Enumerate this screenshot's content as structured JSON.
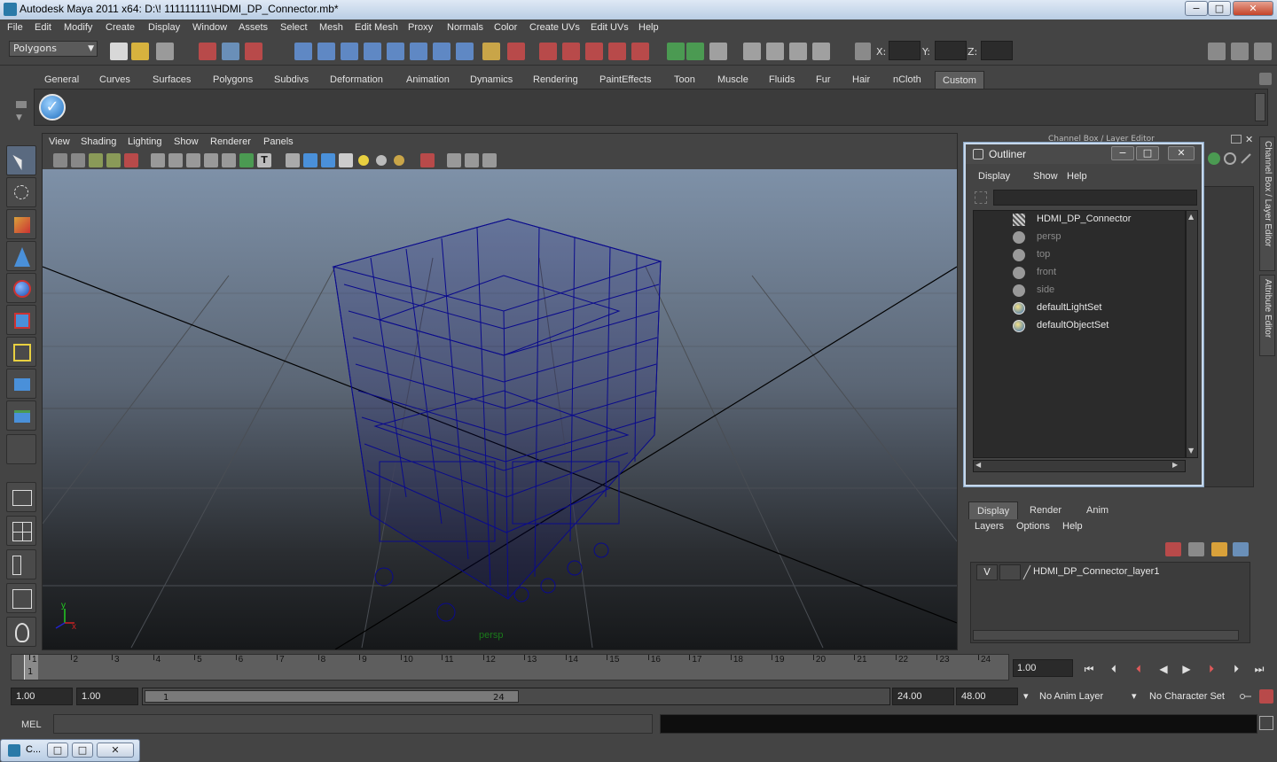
{
  "window": {
    "title": "Autodesk Maya 2011 x64: D:\\! 111111111\\HDMI_DP_Connector.mb*",
    "minimize": "−",
    "maximize": "□",
    "close": "✕"
  },
  "menubar": [
    "File",
    "Edit",
    "Modify",
    "Create",
    "Display",
    "Window",
    "Assets",
    "Select",
    "Mesh",
    "Edit Mesh",
    "Proxy",
    "Normals",
    "Color",
    "Create UVs",
    "Edit UVs",
    "Help"
  ],
  "statusline": {
    "mode": "Polygons",
    "x_label": "X:",
    "y_label": "Y:",
    "z_label": "Z:"
  },
  "shelf": {
    "tabs": [
      "General",
      "Curves",
      "Surfaces",
      "Polygons",
      "Subdivs",
      "Deformation",
      "Animation",
      "Dynamics",
      "Rendering",
      "PaintEffects",
      "Toon",
      "Muscle",
      "Fluids",
      "Fur",
      "Hair",
      "nCloth",
      "Custom"
    ],
    "active_tab": "Custom"
  },
  "viewport": {
    "menu": [
      "View",
      "Shading",
      "Lighting",
      "Show",
      "Renderer",
      "Panels"
    ],
    "camera_label": "persp",
    "wire_color": "#0a0a8c"
  },
  "channelbox": {
    "title": "Channel Box / Layer Editor"
  },
  "side_tabs": [
    "Channel Box / Layer Editor",
    "Attribute Editor"
  ],
  "outliner": {
    "title": "Outliner",
    "menu": [
      "Display",
      "Show",
      "Help"
    ],
    "items": [
      {
        "label": "HDMI_DP_Connector",
        "icon": "mesh-icon",
        "dim": false
      },
      {
        "label": "persp",
        "icon": "camera-icon",
        "dim": true
      },
      {
        "label": "top",
        "icon": "camera-icon",
        "dim": true
      },
      {
        "label": "front",
        "icon": "camera-icon",
        "dim": true
      },
      {
        "label": "side",
        "icon": "camera-icon",
        "dim": true
      },
      {
        "label": "defaultLightSet",
        "icon": "set-icon",
        "dim": false
      },
      {
        "label": "defaultObjectSet",
        "icon": "set-icon",
        "dim": false
      }
    ]
  },
  "layer_editor": {
    "tabs": [
      "Display",
      "Render",
      "Anim"
    ],
    "active_tab": "Display",
    "menu": [
      "Layers",
      "Options",
      "Help"
    ],
    "layer": {
      "visible": "V",
      "name": "HDMI_DP_Connector_layer1"
    }
  },
  "timeline": {
    "start": 1,
    "end": 24,
    "current": 1,
    "current_time": "1.00"
  },
  "range": {
    "start_time": "1.00",
    "playback_start": "1.00",
    "range_lo": "1",
    "range_hi": "24",
    "playback_end": "24.00",
    "end_time": "48.00",
    "anim_layer": "No Anim Layer",
    "character_set": "No Character Set"
  },
  "commandline": {
    "label": "MEL"
  },
  "minimized_window": {
    "title": "C..."
  }
}
